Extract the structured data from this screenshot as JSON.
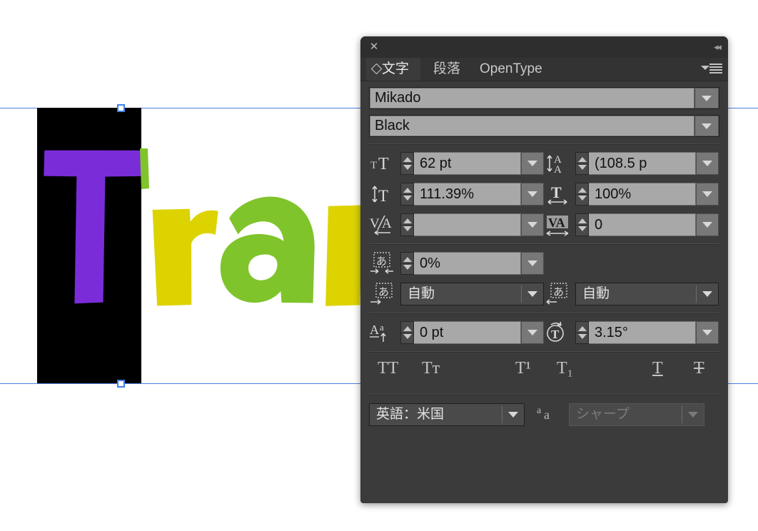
{
  "canvas": {
    "artwork_text": "Tran",
    "letters": [
      {
        "char": "T",
        "color": "#7B2CD9",
        "name": "letter-t-purple"
      },
      {
        "char": "r",
        "color": "#DCD300",
        "name": "letter-r-yellow"
      },
      {
        "char": "a",
        "color": "#7FC42B",
        "name": "letter-a-green"
      },
      {
        "char": "n",
        "color": "#DCD300",
        "name": "letter-n-yellow"
      }
    ],
    "background_rect_color": "#000000",
    "guide_color": "#4a7fe0",
    "handle_color": "#3d7ef0"
  },
  "panel": {
    "titlebar": {
      "close_icon": "close-icon",
      "collapse_icon": "double-chevron-left-icon",
      "collapse_glyph": "◂◂"
    },
    "tabs": [
      {
        "label": "文字",
        "name": "tab-character",
        "active": true
      },
      {
        "label": "段落",
        "name": "tab-paragraph",
        "active": false
      },
      {
        "label": "OpenType",
        "name": "tab-opentype",
        "active": false
      }
    ],
    "menu_icon": "panel-menu-icon",
    "font_family": {
      "value": "Mikado",
      "dropdown_icon": "chevron-down-icon"
    },
    "font_style": {
      "value": "Black",
      "dropdown_icon": "chevron-down-icon"
    },
    "font_size": {
      "icon": "font-size-icon",
      "value": "62 pt"
    },
    "leading": {
      "icon": "leading-icon",
      "value": "(108.5 p"
    },
    "vertical_scale": {
      "icon": "vertical-scale-icon",
      "value": "111.39%"
    },
    "horizontal_scale": {
      "icon": "horizontal-scale-icon",
      "value": "100%"
    },
    "kerning": {
      "icon": "kerning-icon",
      "value": ""
    },
    "tracking": {
      "icon": "tracking-icon",
      "value": "0"
    },
    "tsume": {
      "icon": "tsume-icon",
      "value": "0%"
    },
    "aki_before": {
      "icon": "aki-before-icon",
      "value": "自動"
    },
    "aki_after": {
      "icon": "aki-after-icon",
      "value": "自動"
    },
    "baseline_shift": {
      "icon": "baseline-shift-icon",
      "value": "0 pt"
    },
    "character_rotation": {
      "icon": "character-rotation-icon",
      "value": "3.15°"
    },
    "style_buttons": [
      {
        "name": "all-caps-button",
        "label": "TT"
      },
      {
        "name": "small-caps-button",
        "label": "Tᴛ"
      },
      {
        "name": "superscript-button",
        "label": "T¹"
      },
      {
        "name": "subscript-button",
        "label": "T₁"
      },
      {
        "name": "underline-button",
        "label": "T"
      },
      {
        "name": "strikethrough-button",
        "label": "T"
      }
    ],
    "language": {
      "value": "英語：米国",
      "name": "language-select"
    },
    "anti_aliasing": {
      "icon": "anti-aliasing-icon",
      "value": "シャープ",
      "disabled": true
    }
  }
}
